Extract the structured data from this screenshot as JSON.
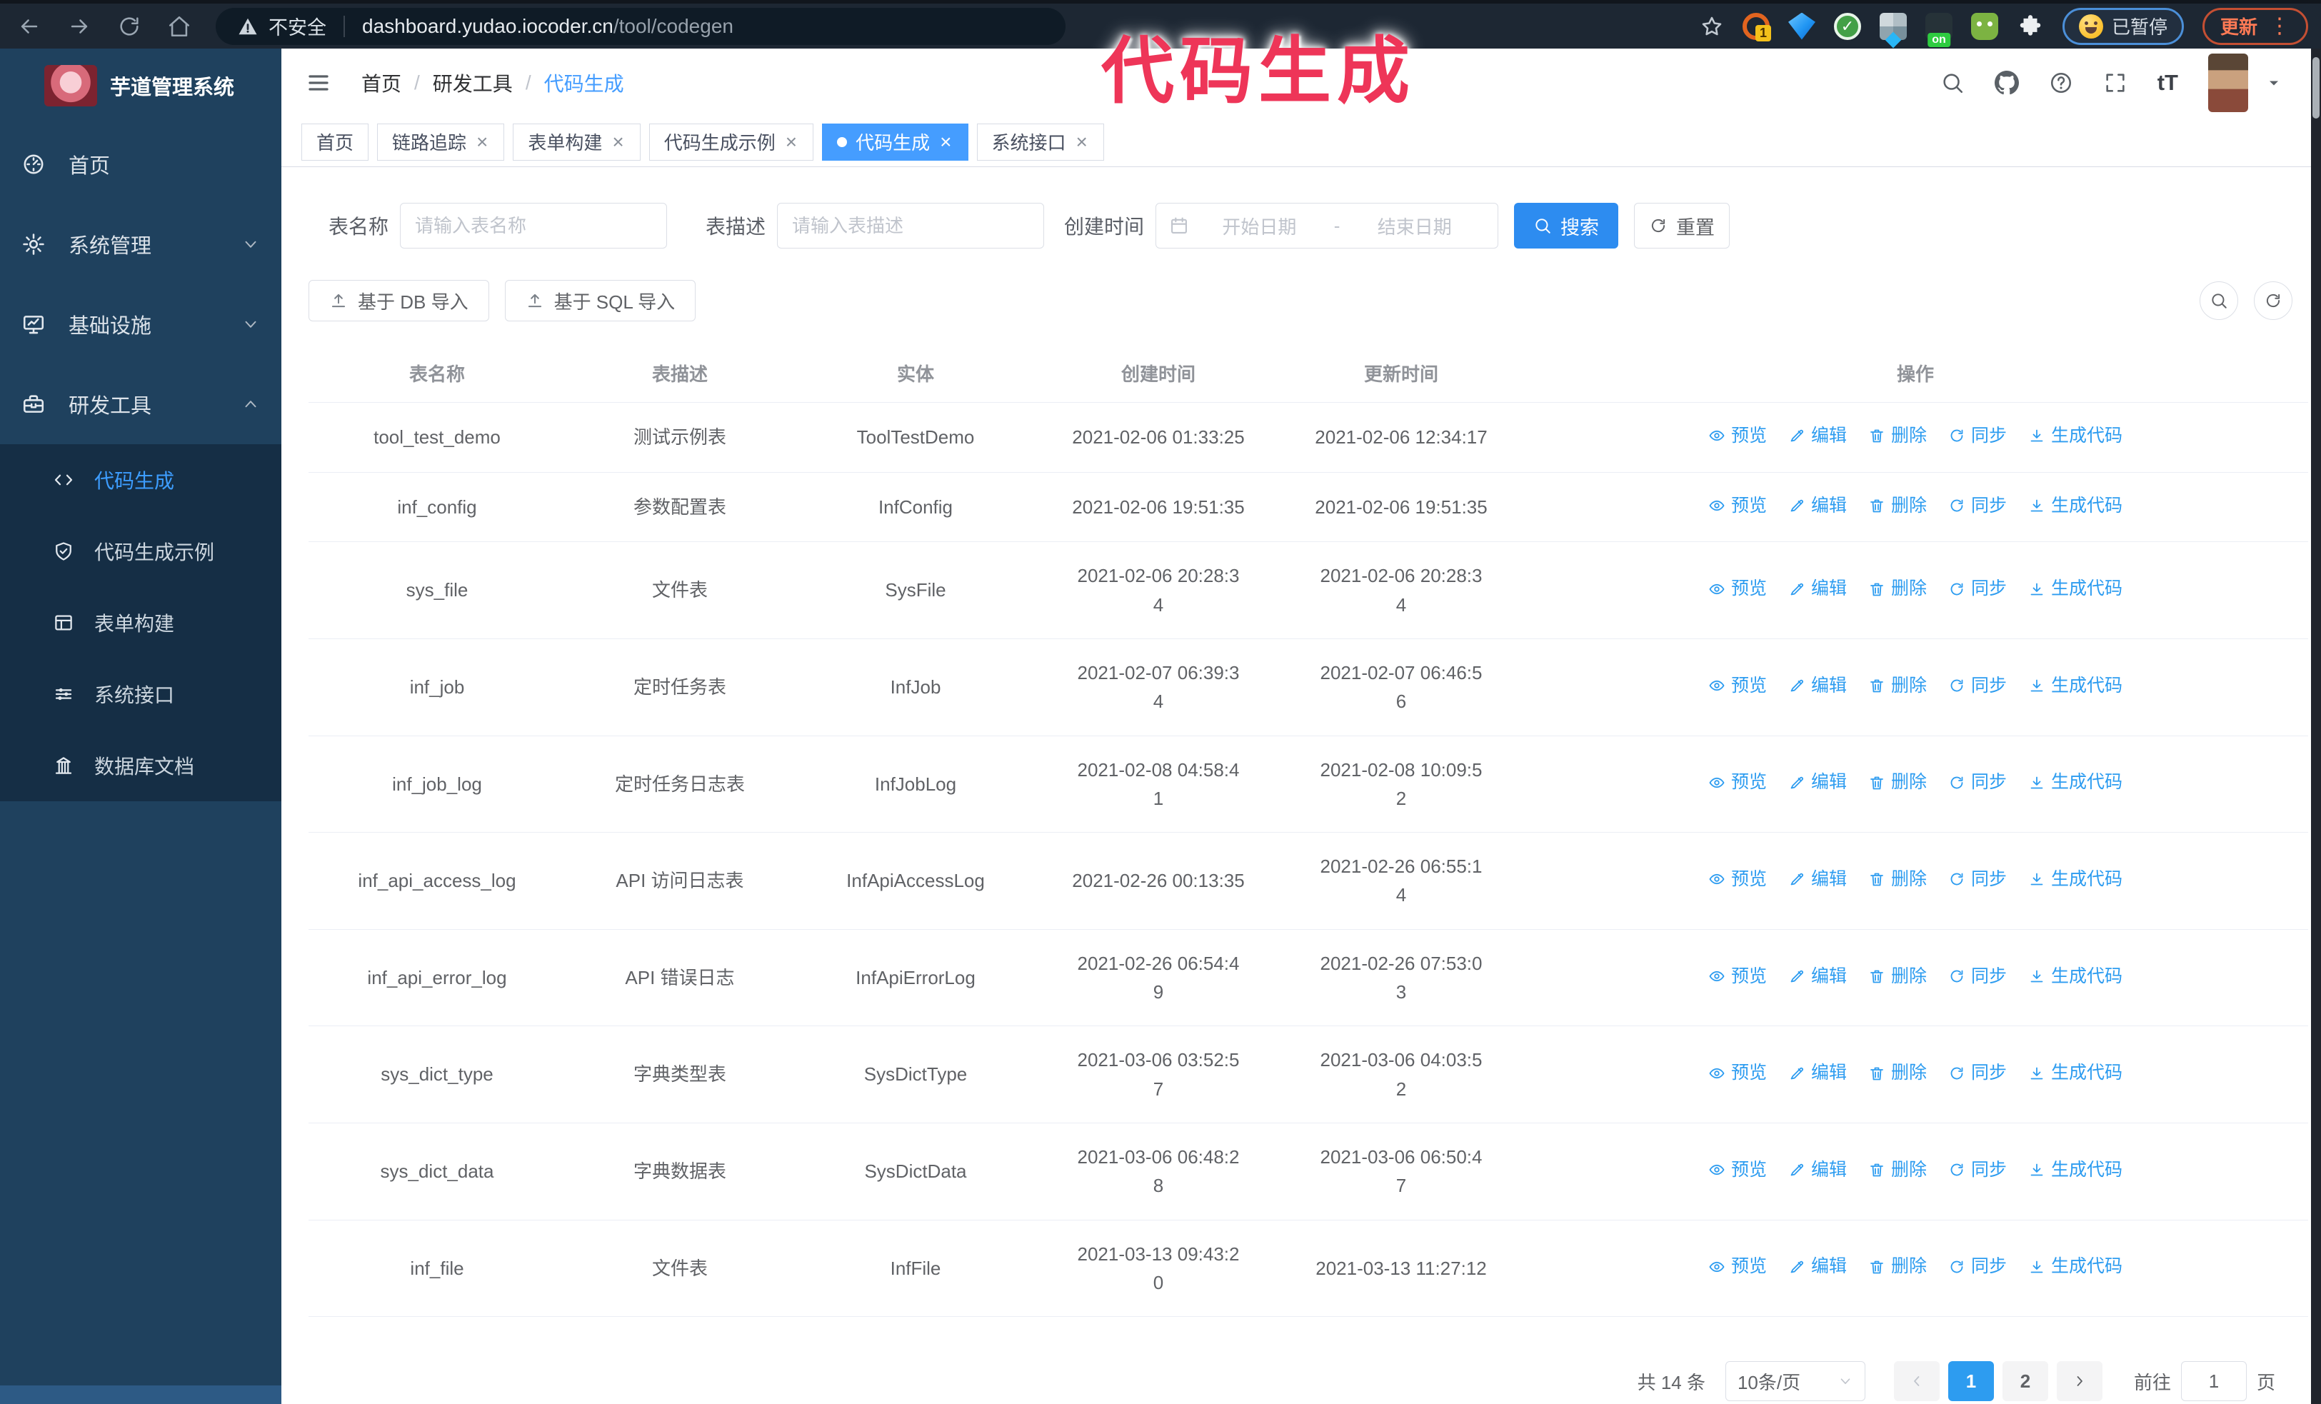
{
  "browser": {
    "security_label": "不安全",
    "url_host": "dashboard.yudao.iocoder.cn",
    "url_path": "/tool/codegen",
    "extension_count_badge": "1",
    "extension_on_badge": "on",
    "extension_check_glyph": "✓",
    "profile_status": "已暂停",
    "update_label": "更新",
    "update_dots": "⋮"
  },
  "overlay": {
    "title": "代码生成",
    "color": "#ee3558"
  },
  "sidebar": {
    "app_title": "芋道管理系统",
    "menu": [
      {
        "label": "首页",
        "icon": "dashboard-icon"
      },
      {
        "label": "系统管理",
        "icon": "gear-icon",
        "chevron": "down"
      },
      {
        "label": "基础设施",
        "icon": "monitor-icon",
        "chevron": "down"
      },
      {
        "label": "研发工具",
        "icon": "toolbox-icon",
        "chevron": "up",
        "expanded": true,
        "children": [
          {
            "label": "代码生成",
            "icon": "code-icon",
            "active": true
          },
          {
            "label": "代码生成示例",
            "icon": "shield-check-icon"
          },
          {
            "label": "表单构建",
            "icon": "form-icon"
          },
          {
            "label": "系统接口",
            "icon": "sliders-icon"
          },
          {
            "label": "数据库文档",
            "icon": "database-icon"
          }
        ]
      }
    ]
  },
  "header": {
    "breadcrumb": [
      "首页",
      "研发工具",
      "代码生成"
    ],
    "font_size_tool": "tT"
  },
  "tabs": [
    {
      "label": "首页",
      "closable": false,
      "active": false
    },
    {
      "label": "链路追踪",
      "closable": true,
      "active": false
    },
    {
      "label": "表单构建",
      "closable": true,
      "active": false
    },
    {
      "label": "代码生成示例",
      "closable": true,
      "active": false
    },
    {
      "label": "代码生成",
      "closable": true,
      "active": true
    },
    {
      "label": "系统接口",
      "closable": true,
      "active": false
    }
  ],
  "filters": {
    "table_name_label": "表名称",
    "table_name_placeholder": "请输入表名称",
    "table_desc_label": "表描述",
    "table_desc_placeholder": "请输入表描述",
    "create_time_label": "创建时间",
    "date_start_placeholder": "开始日期",
    "date_separator": "-",
    "date_end_placeholder": "结束日期",
    "search_button": "搜索",
    "reset_button": "重置"
  },
  "toolbar": {
    "import_db_button": "基于 DB 导入",
    "import_sql_button": "基于 SQL 导入"
  },
  "table": {
    "columns": [
      "表名称",
      "表描述",
      "实体",
      "创建时间",
      "更新时间",
      "操作"
    ],
    "actions": [
      {
        "label": "预览",
        "icon": "eye-icon"
      },
      {
        "label": "编辑",
        "icon": "edit-icon"
      },
      {
        "label": "删除",
        "icon": "delete-icon"
      },
      {
        "label": "同步",
        "icon": "sync-icon"
      },
      {
        "label": "生成代码",
        "icon": "download-icon"
      }
    ],
    "rows": [
      {
        "name": "tool_test_demo",
        "desc": "测试示例表",
        "entity": "ToolTestDemo",
        "created": "2021-02-06 01:33:25",
        "updated": "2021-02-06 12:34:17"
      },
      {
        "name": "inf_config",
        "desc": "参数配置表",
        "entity": "InfConfig",
        "created": "2021-02-06 19:51:35",
        "updated": "2021-02-06 19:51:35"
      },
      {
        "name": "sys_file",
        "desc": "文件表",
        "entity": "SysFile",
        "created": "2021-02-06 20:28:3\n4",
        "updated": "2021-02-06 20:28:3\n4"
      },
      {
        "name": "inf_job",
        "desc": "定时任务表",
        "entity": "InfJob",
        "created": "2021-02-07 06:39:3\n4",
        "updated": "2021-02-07 06:46:5\n6"
      },
      {
        "name": "inf_job_log",
        "desc": "定时任务日志表",
        "entity": "InfJobLog",
        "created": "2021-02-08 04:58:4\n1",
        "updated": "2021-02-08 10:09:5\n2"
      },
      {
        "name": "inf_api_access_log",
        "desc": "API 访问日志表",
        "entity": "InfApiAccessLog",
        "created": "2021-02-26 00:13:35",
        "updated": "2021-02-26 06:55:1\n4"
      },
      {
        "name": "inf_api_error_log",
        "desc": "API 错误日志",
        "entity": "InfApiErrorLog",
        "created": "2021-02-26 06:54:4\n9",
        "updated": "2021-02-26 07:53:0\n3"
      },
      {
        "name": "sys_dict_type",
        "desc": "字典类型表",
        "entity": "SysDictType",
        "created": "2021-03-06 03:52:5\n7",
        "updated": "2021-03-06 04:03:5\n2"
      },
      {
        "name": "sys_dict_data",
        "desc": "字典数据表",
        "entity": "SysDictData",
        "created": "2021-03-06 06:48:2\n8",
        "updated": "2021-03-06 06:50:4\n7"
      },
      {
        "name": "inf_file",
        "desc": "文件表",
        "entity": "InfFile",
        "created": "2021-03-13 09:43:2\n0",
        "updated": "2021-03-13 11:27:12"
      }
    ]
  },
  "pagination": {
    "total_label": "共 14 条",
    "page_size": "10条/页",
    "pages": [
      "1",
      "2"
    ],
    "active_page": "1",
    "goto_label": "前往",
    "goto_value": "1",
    "goto_unit": "页"
  },
  "colors": {
    "accent": "#2d9cf0",
    "sidebar_bg": "#1f415e",
    "submenu_bg": "#152e45",
    "browser_bar": "#1d2733",
    "overlay_pink": "#ee3558"
  }
}
